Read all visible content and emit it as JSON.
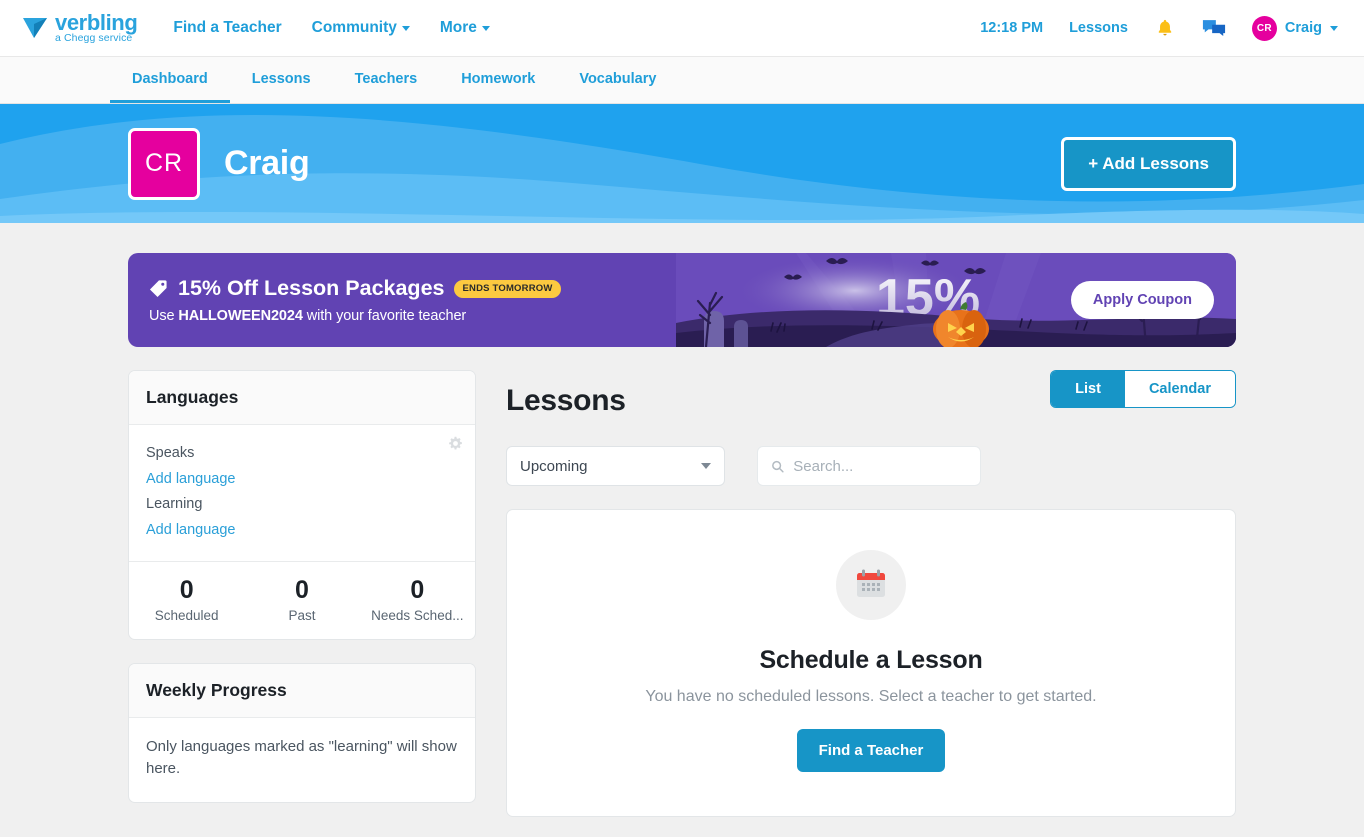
{
  "header": {
    "logo": {
      "name": "verbling",
      "tagline": "a Chegg service",
      "icon": "verbling-logo-icon"
    },
    "nav": [
      {
        "label": "Find a Teacher",
        "dropdown": false
      },
      {
        "label": "Community",
        "dropdown": true
      },
      {
        "label": "More",
        "dropdown": true
      }
    ],
    "time": "12:18 PM",
    "lessons_link": "Lessons",
    "notifications_icon": "bell-icon",
    "messages_icon": "chat-bubbles-icon",
    "user": {
      "initials": "CR",
      "name": "Craig"
    }
  },
  "tabs": [
    {
      "label": "Dashboard",
      "active": true
    },
    {
      "label": "Lessons",
      "active": false
    },
    {
      "label": "Teachers",
      "active": false
    },
    {
      "label": "Homework",
      "active": false
    },
    {
      "label": "Vocabulary",
      "active": false
    }
  ],
  "hero": {
    "avatar_initials": "CR",
    "name": "Craig",
    "add_lessons_label": "+ Add Lessons"
  },
  "promo": {
    "tag_icon": "price-tag-icon",
    "title": "15% Off Lesson Packages",
    "badge": "ENDS TOMORROW",
    "subtitle_prefix": "Use ",
    "code": "HALLOWEEN2024",
    "subtitle_suffix": " with your favorite teacher",
    "button_label": "Apply Coupon",
    "art_percent": "15%",
    "colors": {
      "background": "#6143b3",
      "badge": "#fcc940"
    }
  },
  "languages_card": {
    "title": "Languages",
    "settings_icon": "gear-icon",
    "speaks_label": "Speaks",
    "speaks_action": "Add language",
    "learning_label": "Learning",
    "learning_action": "Add language",
    "stats": [
      {
        "value": "0",
        "label": "Scheduled"
      },
      {
        "value": "0",
        "label": "Past"
      },
      {
        "value": "0",
        "label": "Needs Sched..."
      }
    ]
  },
  "weekly_progress_card": {
    "title": "Weekly Progress",
    "body": "Only languages marked as \"learning\" will show here."
  },
  "lessons": {
    "title": "Lessons",
    "view_toggle": [
      {
        "label": "List",
        "active": true
      },
      {
        "label": "Calendar",
        "active": false
      }
    ],
    "filter_value": "Upcoming",
    "search_placeholder": "Search...",
    "search_value": "",
    "search_icon": "search-icon",
    "empty_state": {
      "icon": "calendar-icon",
      "title": "Schedule a Lesson",
      "description": "You have no scheduled lessons. Select a teacher to get started.",
      "button_label": "Find a Teacher"
    }
  },
  "colors": {
    "accent": "#1795c7",
    "link": "#1f9ed9",
    "avatar": "#e5009e"
  }
}
